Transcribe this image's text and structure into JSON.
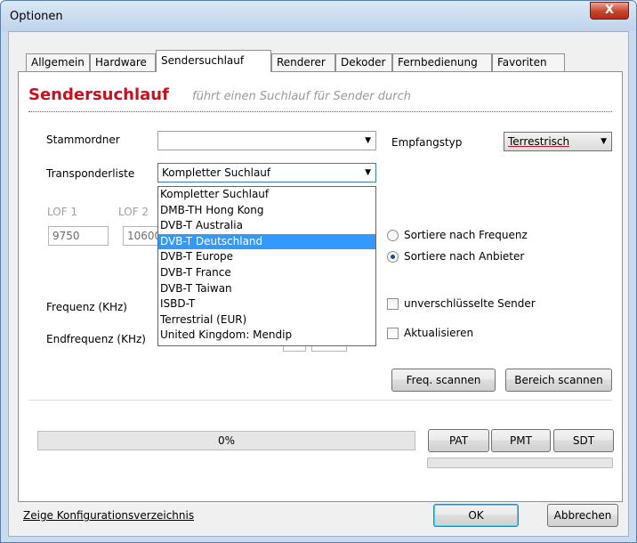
{
  "window": {
    "title": "Optionen",
    "close_label": "X"
  },
  "tabs": [
    {
      "label": "Allgemein"
    },
    {
      "label": "Hardware"
    },
    {
      "label": "Sendersuchlauf"
    },
    {
      "label": "Renderer"
    },
    {
      "label": "Dekoder"
    },
    {
      "label": "Fernbedienung"
    },
    {
      "label": "Favoriten"
    }
  ],
  "header": {
    "title": "Sendersuchlauf",
    "subtitle": "führt einen Suchlauf für Sender durch"
  },
  "form": {
    "stammordner_label": "Stammordner",
    "stammordner_value": "",
    "empfangstyp_label": "Empfangstyp",
    "empfangstyp_value": "Terrestrisch",
    "transponder_label": "Transponderliste",
    "transponder_value": "Kompletter Suchlauf",
    "lof1_label": "LOF 1",
    "lof2_label": "LOF 2",
    "lof1_value": "9750",
    "lof2_value": "10600",
    "frequenz_label": "Frequenz (KHz)",
    "endfrequenz_label": "Endfrequenz (KHz)"
  },
  "dropdown": {
    "items": [
      "Kompletter Suchlauf",
      "DMB-TH Hong Kong",
      "DVB-T Australia",
      "DVB-T Deutschland",
      "DVB-T Europe",
      "DVB-T France",
      "DVB-T Taiwan",
      "ISBD-T",
      "Terrestrial (EUR)",
      "United Kingdom: Mendip"
    ],
    "selected_index": 3
  },
  "options": {
    "sort_freq_label": "Sortiere nach Frequenz",
    "sort_anbieter_label": "Sortiere nach Anbieter",
    "unverschluesselt_label": "unverschlüsselte Sender",
    "aktualisieren_label": "Aktualisieren"
  },
  "buttons": {
    "freq_scan": "Freq. scannen",
    "bereich_scan": "Bereich scannen",
    "pat": "PAT",
    "pmt": "PMT",
    "sdt": "SDT",
    "ok": "OK",
    "cancel": "Abbrechen"
  },
  "progress": {
    "label": "0%",
    "value": 0
  },
  "footer": {
    "config_link": "Zeige Konfigurationsverzeichnis"
  }
}
